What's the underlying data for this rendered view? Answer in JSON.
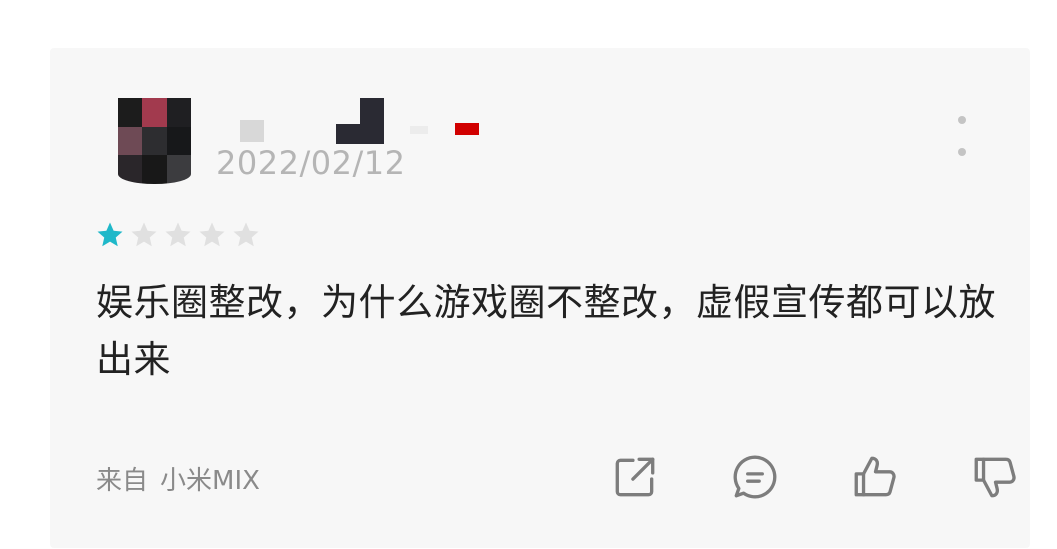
{
  "review": {
    "date": "2022/02/12",
    "rating": 1,
    "max_rating": 5,
    "text": "娱乐圈整改，为什么游戏圈不整改，虚假宣传都可以放出来",
    "device_prefix": "来自",
    "device_name": "小米MIX"
  },
  "icons": {
    "more": "more-vertical-icon",
    "share": "share-icon",
    "comment": "comment-icon",
    "like": "thumbs-up-icon",
    "dislike": "thumbs-down-icon"
  },
  "colors": {
    "star_active": "#1fb8c9",
    "star_inactive": "#e0e0e0",
    "icon_gray": "#7d7d7d",
    "date_gray": "#b5b5b5"
  }
}
